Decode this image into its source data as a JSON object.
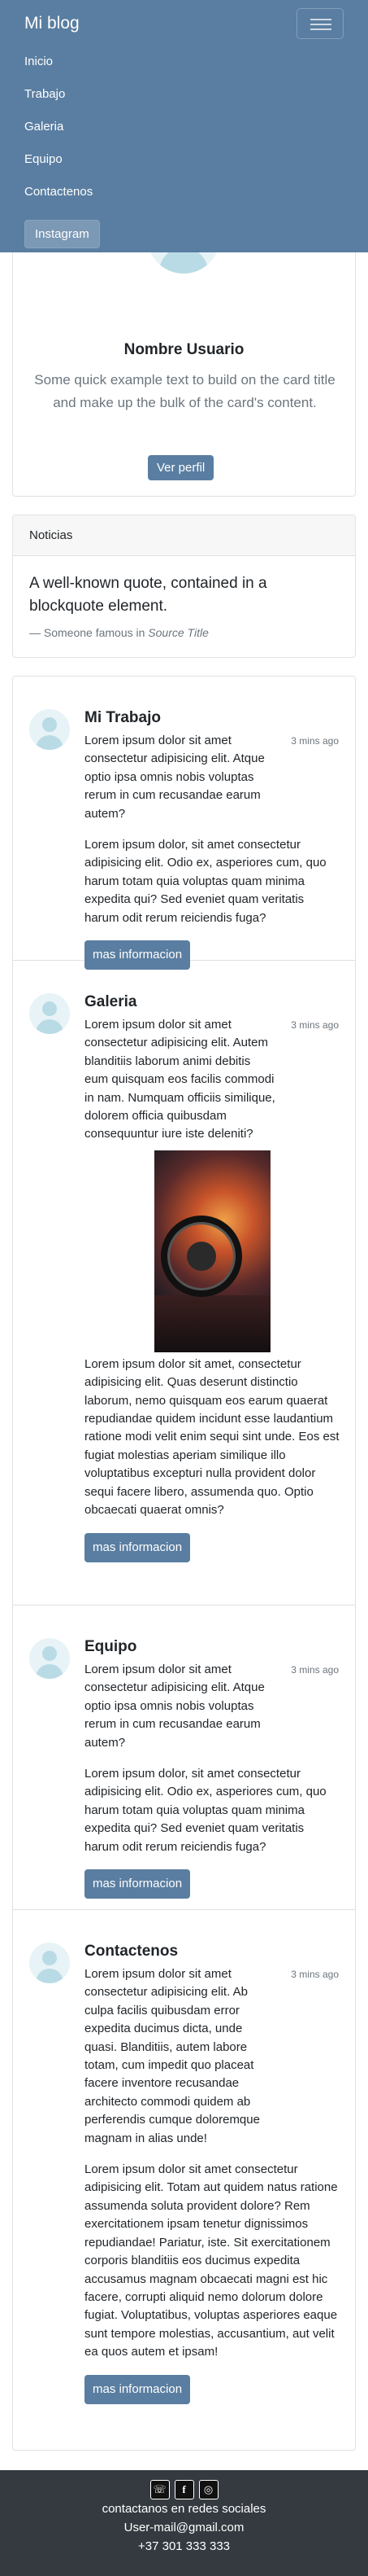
{
  "navbar": {
    "brand": "Mi blog",
    "links": [
      "Inicio",
      "Trabajo",
      "Galeria",
      "Equipo",
      "Contactenos"
    ],
    "instagram_label": "Instagram"
  },
  "profile": {
    "name": "Nombre Usuario",
    "text": "Some quick example text to build on the card title and make up the bulk of the card's content.",
    "button": "Ver perfil"
  },
  "news": {
    "header": "Noticias",
    "quote": "A well-known quote, contained in a blockquote element.",
    "footer_prefix": "— Someone famous in ",
    "footer_cite": "Source Title"
  },
  "posts": [
    {
      "title": "Mi Trabajo",
      "time": "3 mins ago",
      "p1": "Lorem ipsum dolor sit amet consectetur adipisicing elit. Atque optio ipsa omnis nobis voluptas rerum in cum recusandae earum autem?",
      "p2": "Lorem ipsum dolor, sit amet consectetur adipisicing elit. Odio ex, asperiores cum, quo harum totam quia voluptas quam minima expedita qui? Sed eveniet quam veritatis harum odit rerum reiciendis fuga?",
      "button": "mas informacion"
    },
    {
      "title": "Galeria",
      "time": "3 mins ago",
      "p1": "Lorem ipsum dolor sit amet consectetur adipisicing elit. Autem blanditiis laborum animi debitis eum quisquam eos facilis commodi in nam. Numquam officiis similique, dolorem officia quibusdam consequuntur iure iste deleniti?",
      "p2": "Lorem ipsum dolor sit amet, consectetur adipisicing elit. Quas deserunt distinctio laborum, nemo quisquam eos earum quaerat repudiandae quidem incidunt esse laudantium ratione modi velit enim sequi sint unde. Eos est fugiat molestias aperiam similique illo voluptatibus excepturi nulla provident dolor sequi facere libero, assumenda quo. Optio obcaecati quaerat omnis?",
      "button": "mas informacion"
    },
    {
      "title": "Equipo",
      "time": "3 mins ago",
      "p1": "Lorem ipsum dolor sit amet consectetur adipisicing elit. Atque optio ipsa omnis nobis voluptas rerum in cum recusandae earum autem?",
      "p2": "Lorem ipsum dolor, sit amet consectetur adipisicing elit. Odio ex, asperiores cum, quo harum totam quia voluptas quam minima expedita qui? Sed eveniet quam veritatis harum odit rerum reiciendis fuga?",
      "button": "mas informacion"
    },
    {
      "title": "Contactenos",
      "time": "3 mins ago",
      "p1": "Lorem ipsum dolor sit amet consectetur adipisicing elit. Ab culpa facilis quibusdam error expedita ducimus dicta, unde quasi. Blanditiis, autem labore totam, cum impedit quo placeat facere inventore recusandae architecto commodi quidem ab perferendis cumque doloremque magnam in alias unde!",
      "p2": "Lorem ipsum dolor sit amet consectetur adipisicing elit. Totam aut quidem natus ratione assumenda soluta provident dolore? Rem exercitationem ipsam tenetur dignissimos repudiandae! Pariatur, iste. Sit exercitationem corporis blanditiis eos ducimus expedita accusamus magnam obcaecati magni est hic facere, corrupti aliquid nemo dolorum dolore fugiat. Voluptatibus, voluptas asperiores eaque sunt tempore molestias, accusantium, aut velit ea quos autem et ipsam!",
      "button": "mas informacion"
    }
  ],
  "footer": {
    "icons": [
      "whatsapp-icon",
      "facebook-icon",
      "instagram-icon"
    ],
    "line1": "contactanos en redes sociales",
    "line2": "User-mail@gmail.com",
    "line3": "+37 301 333 333"
  }
}
